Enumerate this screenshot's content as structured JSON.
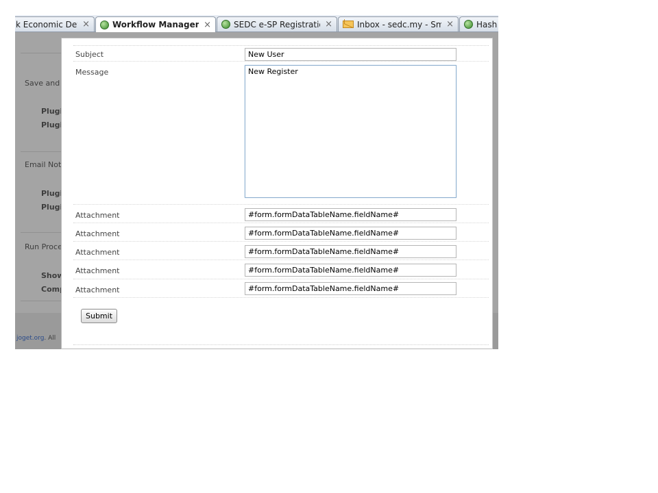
{
  "browser": {
    "tabs": [
      {
        "title": "k Economic Dev...",
        "icon": "none",
        "close": "×"
      },
      {
        "title": "Workflow Manageme...",
        "icon": "globe-icon",
        "close": "×",
        "active": true
      },
      {
        "title": "SEDC e-SP Registration ...",
        "icon": "globe-icon",
        "close": "×"
      },
      {
        "title": "Inbox - sedc.my - Smar...",
        "icon": "envelope-icon",
        "close": "×"
      },
      {
        "title": "Hash \\",
        "icon": "globe-icon",
        "close": ""
      }
    ]
  },
  "background_page": {
    "sections": [
      {
        "title": "Save and Up",
        "items": [
          "Plugin",
          "Plugin"
        ]
      },
      {
        "title": "Email Notifi",
        "items": [
          "Plugin",
          "Plugin"
        ]
      },
      {
        "title": "Run Proces",
        "items": [
          "Show",
          "Comp"
        ]
      }
    ],
    "footer_link": "joget.org",
    "footer_text": ". All"
  },
  "dialog": {
    "subject_label": "Subject",
    "subject_value": "New User",
    "message_label": "Message",
    "message_value": "New Register",
    "attachments": [
      {
        "label": "Attachment",
        "value": "#form.formDataTableName.fieldName#"
      },
      {
        "label": "Attachment",
        "value": "#form.formDataTableName.fieldName#"
      },
      {
        "label": "Attachment",
        "value": "#form.formDataTableName.fieldName#"
      },
      {
        "label": "Attachment",
        "value": "#form.formDataTableName.fieldName#"
      },
      {
        "label": "Attachment",
        "value": "#form.formDataTableName.fieldName#"
      }
    ],
    "submit_label": "Submit"
  },
  "colors": {
    "overlay_gray": "#a4a4a4",
    "dialog_bg": "#ffffff",
    "textarea_focus_border": "#8fb0d0",
    "link_blue": "#2a4b8a"
  }
}
